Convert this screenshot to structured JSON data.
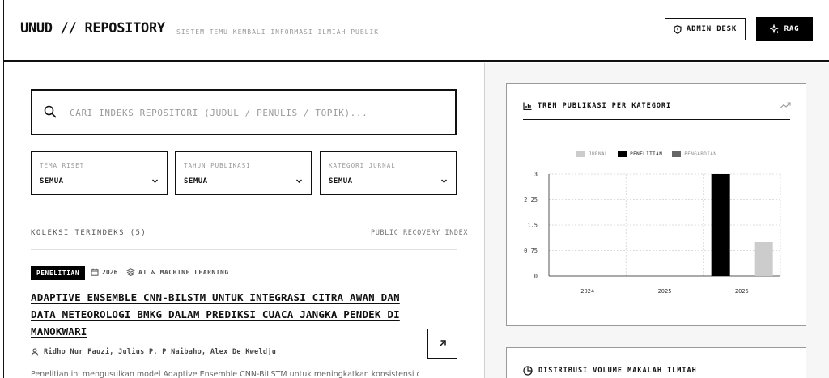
{
  "header": {
    "logo": "UNUD // REPOSITORY",
    "tagline": "SISTEM TEMU KEMBALI INFORMASI ILMIAH PUBLIK",
    "admin_label": "ADMIN DESK",
    "rag_label": "RAG"
  },
  "search": {
    "placeholder": "CARI INDEKS REPOSITORI (JUDUL / PENULIS / TOPIK)...",
    "value": ""
  },
  "filters": [
    {
      "label": "TEMA RISET",
      "value": "SEMUA"
    },
    {
      "label": "TAHUN PUBLIKASI",
      "value": "SEMUA"
    },
    {
      "label": "KATEGORI JURNAL",
      "value": "SEMUA"
    }
  ],
  "collection": {
    "count_label": "KOLEKSI TERINDEKS (5)",
    "index_link": "PUBLIC RECOVERY INDEX"
  },
  "article": {
    "badge": "PENELITIAN",
    "year": "2026",
    "topic": "AI & MACHINE LEARNING",
    "title": "ADAPTIVE ENSEMBLE CNN-BILSTM UNTUK INTEGRASI CITRA AWAN DAN DATA METEOROLOGI BMKG DALAM PREDIKSI CUACA JANGKA PENDEK DI MANOKWARI",
    "authors": "Ridho Nur Fauzi, Julius P. P Naibaho, Alex De Kweldju",
    "abstract": "Penelitian ini mengusulkan model Adaptive Ensemble CNN-BiLSTM untuk meningkatkan konsistensi dan"
  },
  "trend_card": {
    "title": "TREN PUBLIKASI PER KATEGORI"
  },
  "distribution_card": {
    "title": "DISTRIBUSI VOLUME MAKALAH ILMIAH"
  },
  "chart_data": {
    "type": "bar",
    "categories": [
      "2024",
      "2025",
      "2026"
    ],
    "series": [
      {
        "name": "JURNAL",
        "values": [
          0,
          0,
          1
        ],
        "color": "#cccccc"
      },
      {
        "name": "PENELITIAN",
        "values": [
          0,
          0,
          3
        ],
        "color": "#000000"
      },
      {
        "name": "PENGABDIAN",
        "values": [
          0,
          0,
          0
        ],
        "color": "#666666"
      }
    ],
    "yticks": [
      "0",
      "0.75",
      "1.5",
      "2.25",
      "3"
    ],
    "ylim": [
      0,
      3
    ],
    "grid": true,
    "legend_position": "top"
  },
  "colors": {
    "accent": "#000000",
    "muted_text": "#9a9a9a",
    "panel_bg": "#f6f6f6"
  }
}
